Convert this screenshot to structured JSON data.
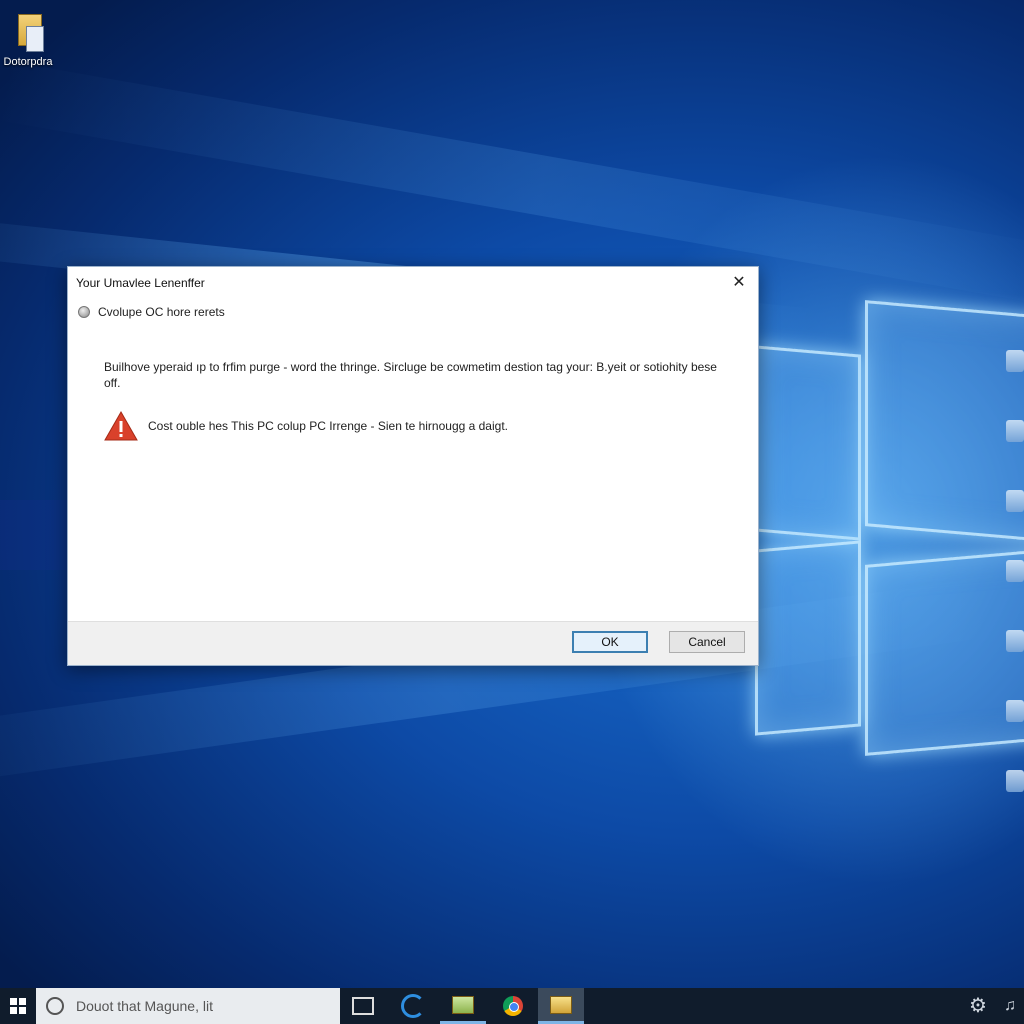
{
  "desktop": {
    "icon_label": "Dotorpdra"
  },
  "dialog": {
    "title": "Your Umavlee Lenenffer",
    "close_glyph": "✕",
    "subheading": "Cvolupe OC hore rerets",
    "body": "Builhove yperaid ıp to frfim purge - word the thringe. Sircluge be cowmetim destion tag your: B.yeit or sotiohity bese off.",
    "warning": "Cost ouble hes This PC colup PC Irrenge - Sien te hirnougg a daigt.",
    "ok_label": "OK",
    "cancel_label": "Cancel"
  },
  "taskbar": {
    "search_placeholder": "Douot that Magune, lit",
    "gear_glyph": "⚙",
    "tray_glyph": "♫"
  }
}
